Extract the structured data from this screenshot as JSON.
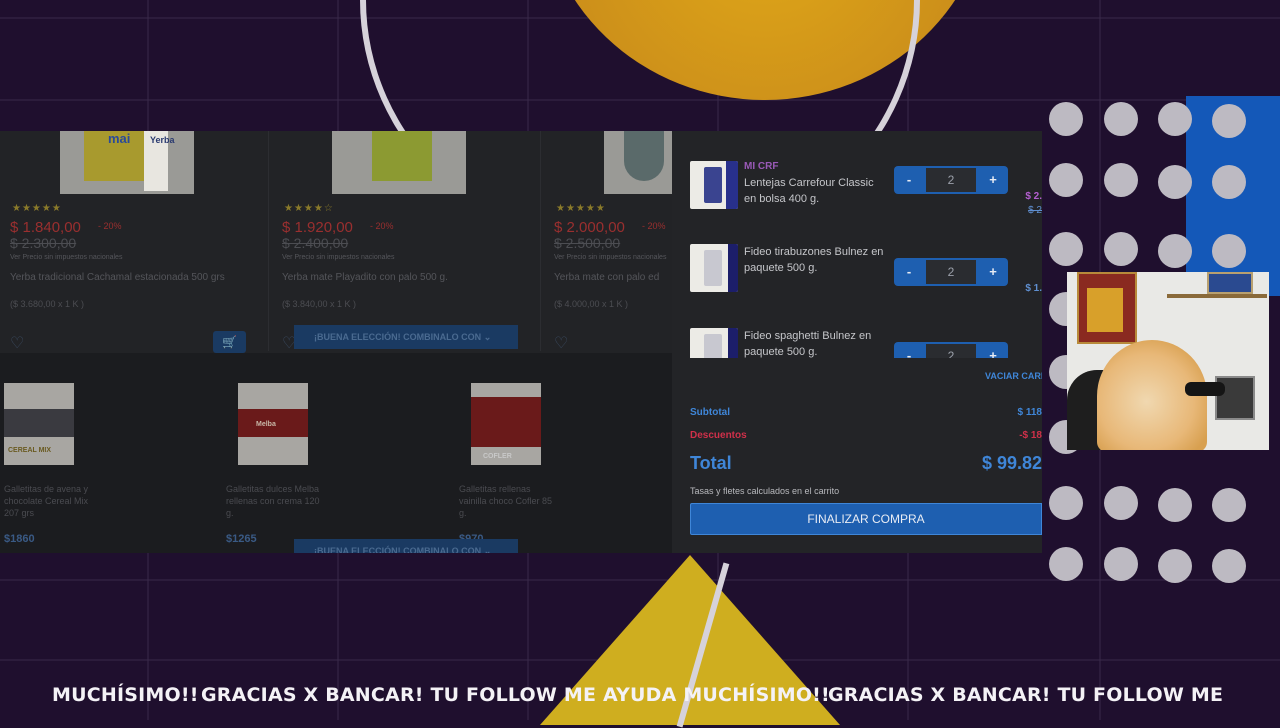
{
  "products": [
    {
      "label": "Yerba",
      "rating": "★★★★★",
      "price": "$ 1.840,00",
      "discount": "- 20%",
      "old_price": "$ 2.300,00",
      "tax_note": "Ver Precio sin impuestos nacionales",
      "name": "Yerba tradicional Cachamal estacionada 500 grs",
      "unit": "($ 3.680,00 x 1 K )"
    },
    {
      "label": "",
      "rating": "★★★★☆",
      "price": "$ 1.920,00",
      "discount": "- 20%",
      "old_price": "$ 2.400,00",
      "tax_note": "Ver Precio sin impuestos nacionales",
      "name": "Yerba mate Playadito con palo 500 g.",
      "unit": "($ 3.840,00 x 1 K )"
    },
    {
      "label": "",
      "rating": "★★★★★",
      "price": "$ 2.000,00",
      "discount": "- 20%",
      "old_price": "$ 2.500,00",
      "tax_note": "Ver Precio sin impuestos nacionales",
      "name": "Yerba mate con palo ed",
      "unit": "($ 4.000,00 x 1 K )"
    }
  ],
  "combine_label": "¡BUENA ELECCIÓN! COMBINALO CON",
  "mini_products": [
    {
      "thumb_label": "CEREAL MIX",
      "name": "Galletitas de avena y chocolate Cereal Mix 207 grs",
      "price": "$1860"
    },
    {
      "thumb_label": "Melba",
      "name": "Galletitas dulces Melba rellenas con crema 120 g.",
      "price": "$1265"
    },
    {
      "thumb_label": "COFLER",
      "name": "Galletitas rellenas vainilla choco Cofler 85 g.",
      "price": "$970"
    }
  ],
  "cart": {
    "items": [
      {
        "brand": "MI CRF",
        "name": "Lentejas Carrefour Classic en bolsa 400 g.",
        "qty": "2",
        "price": "$ 2.",
        "old_price": "$ 2"
      },
      {
        "brand": "",
        "name": "Fideo tirabuzones Bulnez en paquete 500 g.",
        "qty": "2",
        "price": "$ 1."
      },
      {
        "brand": "",
        "name": "Fideo spaghetti Bulnez en paquete 500 g.",
        "qty": "2",
        "price": ""
      }
    ],
    "minus": "-",
    "plus": "+",
    "empty_label": "VACIAR CARRITO",
    "subtotal_label": "Subtotal",
    "subtotal_value": "$ 118",
    "discounts_label": "Descuentos",
    "discounts_value": "-$ 18",
    "total_label": "Total",
    "total_value": "$ 99.82",
    "tax_note": "Tasas y fletes calculados en el carrito",
    "checkout_label": "FINALIZAR COMPRA"
  },
  "ticker_text": "GRACIAS X BANCAR! TU FOLLOW ME AYUDA MUCHÍSIMO!!",
  "ticker_head": "MUCHÍSIMO!!",
  "ticker_tail": "GRACIAS X BANCAR! TU FOLLOW ME",
  "colors": {
    "background": "#1f0f2e",
    "accent_blue": "#1e5fb0",
    "ticker_text": "#f4f2f6",
    "discount_red": "#d0304a"
  }
}
